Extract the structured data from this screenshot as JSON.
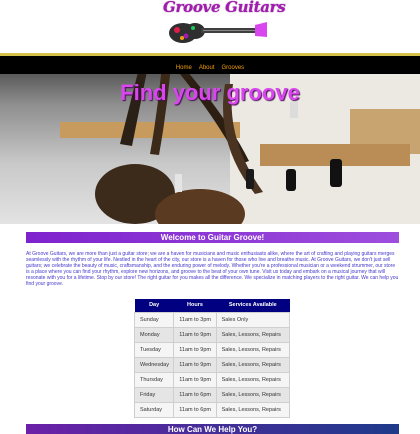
{
  "brand": {
    "name": "Groove Guitars"
  },
  "nav": {
    "items": [
      "Home",
      "About",
      "Grooves"
    ]
  },
  "hero": {
    "title": "Find your groove"
  },
  "welcome": {
    "heading": "Welcome to Guitar Groove!",
    "body": "At Groove Guitars, we are more than just a guitar store; we are a haven for musicians and music enthusiasts alike, where the art of crafting and playing guitars merges seamlessly with the rhythm of your life. Nestled in the heart of the city, our store is a haven for those who live and breathe music. At Groove Guitars, we don't just sell guitars; we celebrate the beauty of music, craftsmanship, and the enduring power of melody. Whether you're a professional musician or a weekend strummer, our store is a place where you can find your rhythm, explore new horizons, and groove to the beat of your own tune. Visit us today and embark on a musical journey that will resonate with you for a lifetime. Stop by our store! The right guitar for you makes all the difference. We specialize in matching players to the right guitar. We can help you find your groove."
  },
  "hours": {
    "columns": [
      "Day",
      "Hours",
      "Services Available"
    ],
    "rows": [
      [
        "Sunday",
        "11am to 3pm",
        "Sales Only"
      ],
      [
        "Monday",
        "11am to 9pm",
        "Sales, Lessons, Repairs"
      ],
      [
        "Tuesday",
        "11am to 9pm",
        "Sales, Lessons, Repairs"
      ],
      [
        "Wednesday",
        "11am to 9pm",
        "Sales, Lessons, Repairs"
      ],
      [
        "Thursday",
        "11am to 9pm",
        "Sales, Lessons, Repairs"
      ],
      [
        "Friday",
        "11am to 6pm",
        "Sales, Lessons, Repairs"
      ],
      [
        "Saturday",
        "11am to 6pm",
        "Sales, Lessons, Repairs"
      ]
    ]
  },
  "help": {
    "heading": "How Can We Help You?"
  },
  "colors": {
    "accent": "#d946ef",
    "nav_bg": "#000000",
    "nav_link": "#f59e0b",
    "table_header": "#000080",
    "section_bar": "#7e22ce"
  }
}
